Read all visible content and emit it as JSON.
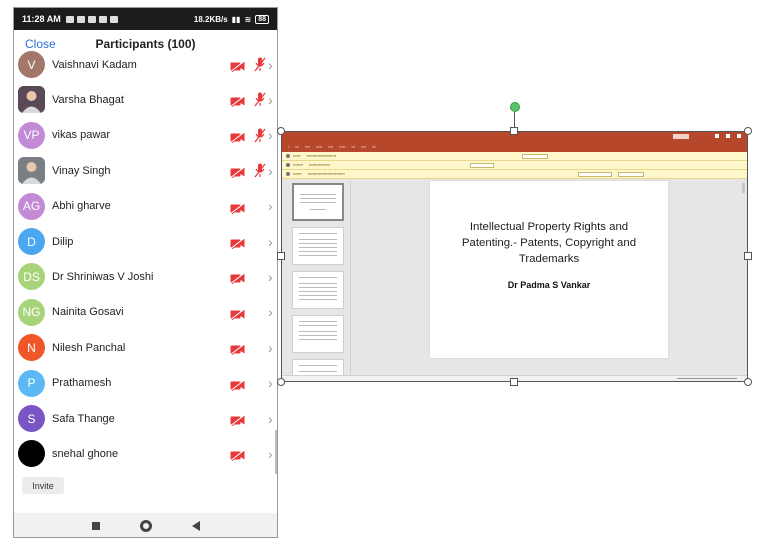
{
  "status_bar": {
    "time": "11:28 AM",
    "network": "18.2KB/s",
    "battery": "88"
  },
  "header": {
    "close_label": "Close",
    "title": "Participants (100)"
  },
  "participants": [
    {
      "name": "Vaishnavi Kadam",
      "initials": "V",
      "color": "#a3776a",
      "video_off": true,
      "muted": true,
      "photo": false
    },
    {
      "name": "Varsha Bhagat",
      "initials": "",
      "color": "#5a4a57",
      "video_off": true,
      "muted": true,
      "photo": true
    },
    {
      "name": "vikas pawar",
      "initials": "VP",
      "color": "#c38ad6",
      "video_off": true,
      "muted": true,
      "photo": false
    },
    {
      "name": "Vinay Singh",
      "initials": "",
      "color": "#7a7f86",
      "video_off": true,
      "muted": true,
      "photo": true
    },
    {
      "name": "Abhi gharve",
      "initials": "AG",
      "color": "#c38ad6",
      "video_off": true,
      "muted": false,
      "photo": false
    },
    {
      "name": "Dilip",
      "initials": "D",
      "color": "#4aa7f0",
      "video_off": true,
      "muted": false,
      "photo": false
    },
    {
      "name": "Dr Shriniwas V Joshi",
      "initials": "DS",
      "color": "#a7d47a",
      "video_off": true,
      "muted": false,
      "photo": false
    },
    {
      "name": "Nainita Gosavi",
      "initials": "NG",
      "color": "#a7d47a",
      "video_off": true,
      "muted": false,
      "photo": false
    },
    {
      "name": "Nilesh Panchal",
      "initials": "N",
      "color": "#f0562a",
      "video_off": true,
      "muted": false,
      "photo": false
    },
    {
      "name": "Prathamesh",
      "initials": "P",
      "color": "#5bb8f5",
      "video_off": true,
      "muted": false,
      "photo": false
    },
    {
      "name": "Safa Thange",
      "initials": "S",
      "color": "#7a56c4",
      "video_off": true,
      "muted": false,
      "photo": false
    },
    {
      "name": "snehal ghone",
      "initials": "",
      "color": "#000000",
      "video_off": true,
      "muted": false,
      "photo": false
    }
  ],
  "invite_label": "Invite",
  "presentation": {
    "slide_title": "Intellectual Property Rights and Patenting.- Patents, Copyright and Trademarks",
    "slide_author": "Dr Padma S Vankar"
  },
  "colors": {
    "accent": "#2d6fd4",
    "video_off_red": "#e8393a",
    "powerpoint_red": "#b7472a",
    "rotate_handle": "#59c26a"
  }
}
